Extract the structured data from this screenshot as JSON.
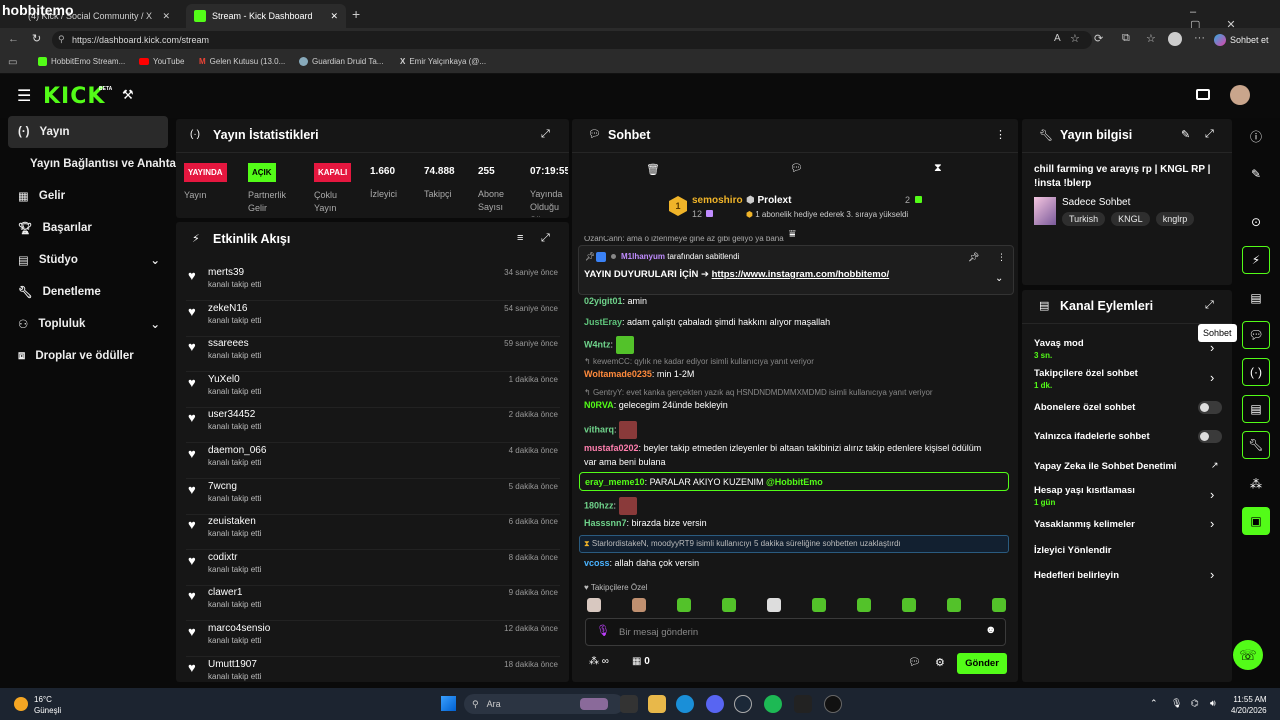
{
  "browser": {
    "overlay_title": "hobbitemo",
    "tabs": [
      {
        "label": "(4) Kick / Social Community / X"
      },
      {
        "label": "Stream - Kick Dashboard"
      }
    ],
    "url": "https://dashboard.kick.com/stream",
    "profile": "Sohbet et",
    "bookmarks": [
      "HobbitEmo Stream...",
      "YouTube",
      "Gelen Kutusu (13.0...",
      "Guardian Druid Ta...",
      "Emir Yalçınkaya (@..."
    ]
  },
  "header": {
    "logo": "KICK",
    "beta": "BETA"
  },
  "sidebar": {
    "items": [
      {
        "label": "Yayın"
      },
      {
        "label": "Yayın Bağlantısı ve Anahtarı"
      },
      {
        "label": "Gelir"
      },
      {
        "label": "Başarılar"
      },
      {
        "label": "Stüdyo"
      },
      {
        "label": "Denetleme"
      },
      {
        "label": "Topluluk"
      },
      {
        "label": "Droplar ve ödüller"
      }
    ]
  },
  "stats": {
    "title": "Yayın İstatistikleri",
    "items": [
      {
        "badge": "YAYINDA",
        "label": "Yayın",
        "color": "#e5173f"
      },
      {
        "badge": "AÇIK",
        "label": "Partnerlik Gelir",
        "color": "#53fc18"
      },
      {
        "badge": "KAPALI",
        "label": "Çoklu Yayın",
        "color": "#e5173f"
      },
      {
        "value": "1.660",
        "label": "İzleyici"
      },
      {
        "value": "74.888",
        "label": "Takipçi"
      },
      {
        "value": "255",
        "label": "Abone Sayısı"
      },
      {
        "value": "07:19:55",
        "label": "Yayında Olduğu Süre"
      }
    ]
  },
  "activity": {
    "title": "Etkinlik Akışı",
    "events": [
      {
        "name": "merts39",
        "sub": "kanalı takip etti",
        "time": "34 saniye önce"
      },
      {
        "name": "zekeN16",
        "sub": "kanalı takip etti",
        "time": "54 saniye önce"
      },
      {
        "name": "ssareees",
        "sub": "kanalı takip etti",
        "time": "59 saniye önce"
      },
      {
        "name": "YuXel0",
        "sub": "kanalı takip etti",
        "time": "1 dakika önce"
      },
      {
        "name": "user34452",
        "sub": "kanalı takip etti",
        "time": "2 dakika önce"
      },
      {
        "name": "daemon_066",
        "sub": "kanalı takip etti",
        "time": "4 dakika önce"
      },
      {
        "name": "7wcng",
        "sub": "kanalı takip etti",
        "time": "5 dakika önce"
      },
      {
        "name": "zeuistaken",
        "sub": "kanalı takip etti",
        "time": "6 dakika önce"
      },
      {
        "name": "codixtr",
        "sub": "kanalı takip etti",
        "time": "8 dakika önce"
      },
      {
        "name": "clawer1",
        "sub": "kanalı takip etti",
        "time": "9 dakika önce"
      },
      {
        "name": "marco4sensio",
        "sub": "kanalı takip etti",
        "time": "12 dakika önce"
      },
      {
        "name": "Umutt1907",
        "sub": "kanalı takip etti",
        "time": "18 dakika önce"
      }
    ]
  },
  "chat": {
    "title": "Sohbet",
    "leader1": {
      "rank": "1",
      "name": "semoshiro",
      "count": "12"
    },
    "leader2": {
      "name": "Prolext",
      "count": "2",
      "note": "1 abonelik hediye ederek 3. sıraya yükseldi"
    },
    "cut_line": "OzanCann: ama o izlenmeye gine az gibi geliyo ya bana",
    "pinned": {
      "by": "M1lhanyum",
      "by_suffix": "tarafından sabitlendi",
      "text": "YAYIN DUYURULARI İÇİN ➔ ",
      "link": "https://www.instagram.com/hobbitemo/"
    },
    "messages": [
      {
        "user": "02yigit01",
        "text": "amin",
        "color": "#6fd38b"
      },
      {
        "user": "JustEray",
        "text": "adam çalıştı çabaladı şimdi hakkını alıyor maşallah",
        "color": "#5ec27a"
      },
      {
        "user": "W4ntz",
        "text": "",
        "color": "#6fd38b"
      },
      {
        "reply": "kewemCC: qylık ne kadar ediyor isimli kullanıcıya yanıt veriyor"
      },
      {
        "user": "Woltamade0235",
        "text": "min 1-2M",
        "color": "#ff8a3c"
      },
      {
        "reply": "GentryY: evet kanka gerçekten yazık aq HSNDNDMDMMXMDMD isimli kullanıcıya yanıt veriyor"
      },
      {
        "user": "N0RVA",
        "text": "gelecegim 24ünde bekleyin",
        "color": "#53fc18"
      },
      {
        "user": "vitharq",
        "text": "",
        "color": "#6fd38b"
      },
      {
        "user": "mustafa0202",
        "text": "beyler takip etmeden izleyenler bi altaan takibinizi alırız takip edenlere kişisel ödülüm",
        "text2": "var ama beni bulana",
        "color": "#ff7fae"
      },
      {
        "user": "eray_meme10",
        "text": "PARALAR AKIYO KUZENIM ",
        "mention": "@HobbitEmo",
        "color": "#53fc18"
      },
      {
        "user": "180hzz",
        "text": "",
        "color": "#6fd38b"
      },
      {
        "user": "Hasssnn7",
        "text": "birazda bize versin",
        "color": "#6fd38b"
      },
      {
        "timeout": "StarlordistakeN, moodyyRT9 isimli kullanıcıyı 5 dakika süreliğine sohbetten uzaklaştırdı"
      },
      {
        "user": "vcoss",
        "text": "allah daha çok versin",
        "color": "#4ab3ff"
      }
    ],
    "followers_only": "Takipçilere Özel",
    "input_placeholder": "Bir mesaj gönderin",
    "infinity": "∞",
    "points": "0",
    "send": "Gönder"
  },
  "streaminfo": {
    "title": "Yayın bilgisi",
    "stream_title": "chill farming ve arayış rp | KNGL RP | !insta !blerp",
    "category": "Sadece Sohbet",
    "tags": [
      "Turkish",
      "KNGL",
      "knglrp"
    ]
  },
  "actions": {
    "title": "Kanal Eylemleri",
    "items": [
      {
        "label": "Yavaş mod",
        "sub": "3 sn."
      },
      {
        "label": "Takipçilere özel sohbet",
        "sub": "1 dk."
      },
      {
        "label": "Abonelere özel sohbet",
        "sub": ""
      },
      {
        "label": "Yalnızca ifadelerle sohbet",
        "sub": ""
      },
      {
        "label": "Yapay Zeka ile Sohbet Denetimi",
        "sub": ""
      },
      {
        "label": "Hesap yaşı kısıtlaması",
        "sub": "1 gün"
      },
      {
        "label": "Yasaklanmış kelimeler",
        "sub": ""
      },
      {
        "label": "İzleyici Yönlendir",
        "sub": ""
      },
      {
        "label": "Hedefleri belirleyin",
        "sub": ""
      }
    ]
  },
  "rail": {
    "tooltip": "Sohbet"
  },
  "taskbar": {
    "weather_temp": "16°C",
    "weather_desc": "Güneşli",
    "search": "Ara",
    "time": "11:55 AM",
    "date": "4/20/2026"
  },
  "colors": {
    "accent": "#53fc18",
    "live": "#e5173f"
  }
}
